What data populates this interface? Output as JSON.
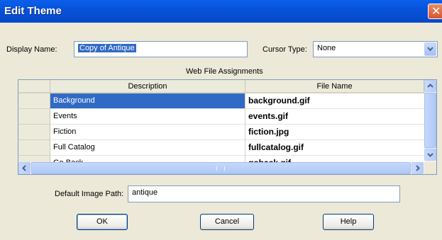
{
  "window": {
    "title": "Edit Theme",
    "close_glyph": "✕"
  },
  "display_name": {
    "label": "Display Name:",
    "value": "Copy of Antique"
  },
  "cursor_type": {
    "label": "Cursor Type:",
    "value": "None"
  },
  "web_files": {
    "caption": "Web File Assignments",
    "columns": [
      "Description",
      "File Name"
    ],
    "rows": [
      {
        "description": "Background",
        "file_name": "background.gif",
        "selected": true
      },
      {
        "description": "Events",
        "file_name": "events.gif"
      },
      {
        "description": "Fiction",
        "file_name": "fiction.jpg"
      },
      {
        "description": "Full Catalog",
        "file_name": "fullcatalog.gif"
      },
      {
        "description": "Go Back",
        "file_name": "goback.gif"
      }
    ]
  },
  "default_image_path": {
    "label": "Default Image Path:",
    "value": "antique"
  },
  "buttons": {
    "ok": "OK",
    "cancel": "Cancel",
    "help": "Help"
  },
  "colors": {
    "title_bar": "#0853d9",
    "selection": "#316ac5",
    "dialog_bg": "#ece9d8"
  }
}
